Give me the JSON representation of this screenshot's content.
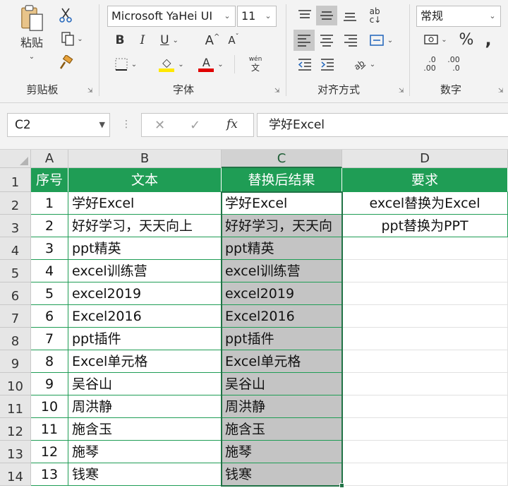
{
  "ribbon": {
    "clipboard": {
      "paste_label": "粘贴",
      "group_label": "剪贴板"
    },
    "font": {
      "font_name": "Microsoft YaHei UI",
      "font_size": "11",
      "group_label": "字体",
      "bold": "B",
      "italic": "I",
      "underline": "U",
      "grow": "A",
      "shrink": "A",
      "font_color_letter": "A",
      "phonetic_top": "wén",
      "phonetic_bottom": "文"
    },
    "alignment": {
      "group_label": "对齐方式"
    },
    "number": {
      "format": "常规",
      "percent": "%",
      "comma": ",",
      "group_label": "数字",
      "inc_decimal_top": ".0",
      "inc_decimal_bottom": ".00",
      "dec_decimal_top": ".00",
      "dec_decimal_bottom": ".0"
    },
    "colors": {
      "highlight": "#ffe800",
      "font_color": "#e00000"
    }
  },
  "formula_bar": {
    "name_box": "C2",
    "formula": "学好Excel",
    "fx": "fx"
  },
  "sheet": {
    "columns": [
      "A",
      "B",
      "C",
      "D"
    ],
    "rows": [
      "1",
      "2",
      "3",
      "4",
      "5",
      "6",
      "7",
      "8",
      "9",
      "10",
      "11",
      "12",
      "13",
      "14"
    ],
    "header_row": [
      "序号",
      "文本",
      "替换后结果",
      "要求"
    ],
    "data": [
      [
        "1",
        "学好Excel",
        "学好Excel",
        "excel替换为Excel"
      ],
      [
        "2",
        "好好学习，天天向上",
        "好好学习，天天向",
        "ppt替换为PPT"
      ],
      [
        "3",
        "ppt精英",
        "ppt精英",
        ""
      ],
      [
        "4",
        "excel训练营",
        "excel训练营",
        ""
      ],
      [
        "5",
        "excel2019",
        "excel2019",
        ""
      ],
      [
        "6",
        "Excel2016",
        "Excel2016",
        ""
      ],
      [
        "7",
        "ppt插件",
        "ppt插件",
        ""
      ],
      [
        "8",
        "Excel单元格",
        "Excel单元格",
        ""
      ],
      [
        "9",
        "吴谷山",
        "吴谷山",
        ""
      ],
      [
        "10",
        "周洪静",
        "周洪静",
        ""
      ],
      [
        "11",
        "施含玉",
        "施含玉",
        ""
      ],
      [
        "12",
        "施琴",
        "施琴",
        ""
      ],
      [
        "13",
        "钱寒",
        "钱寒",
        ""
      ]
    ],
    "header_color": "#1f9d55",
    "selection_color": "#217346"
  }
}
